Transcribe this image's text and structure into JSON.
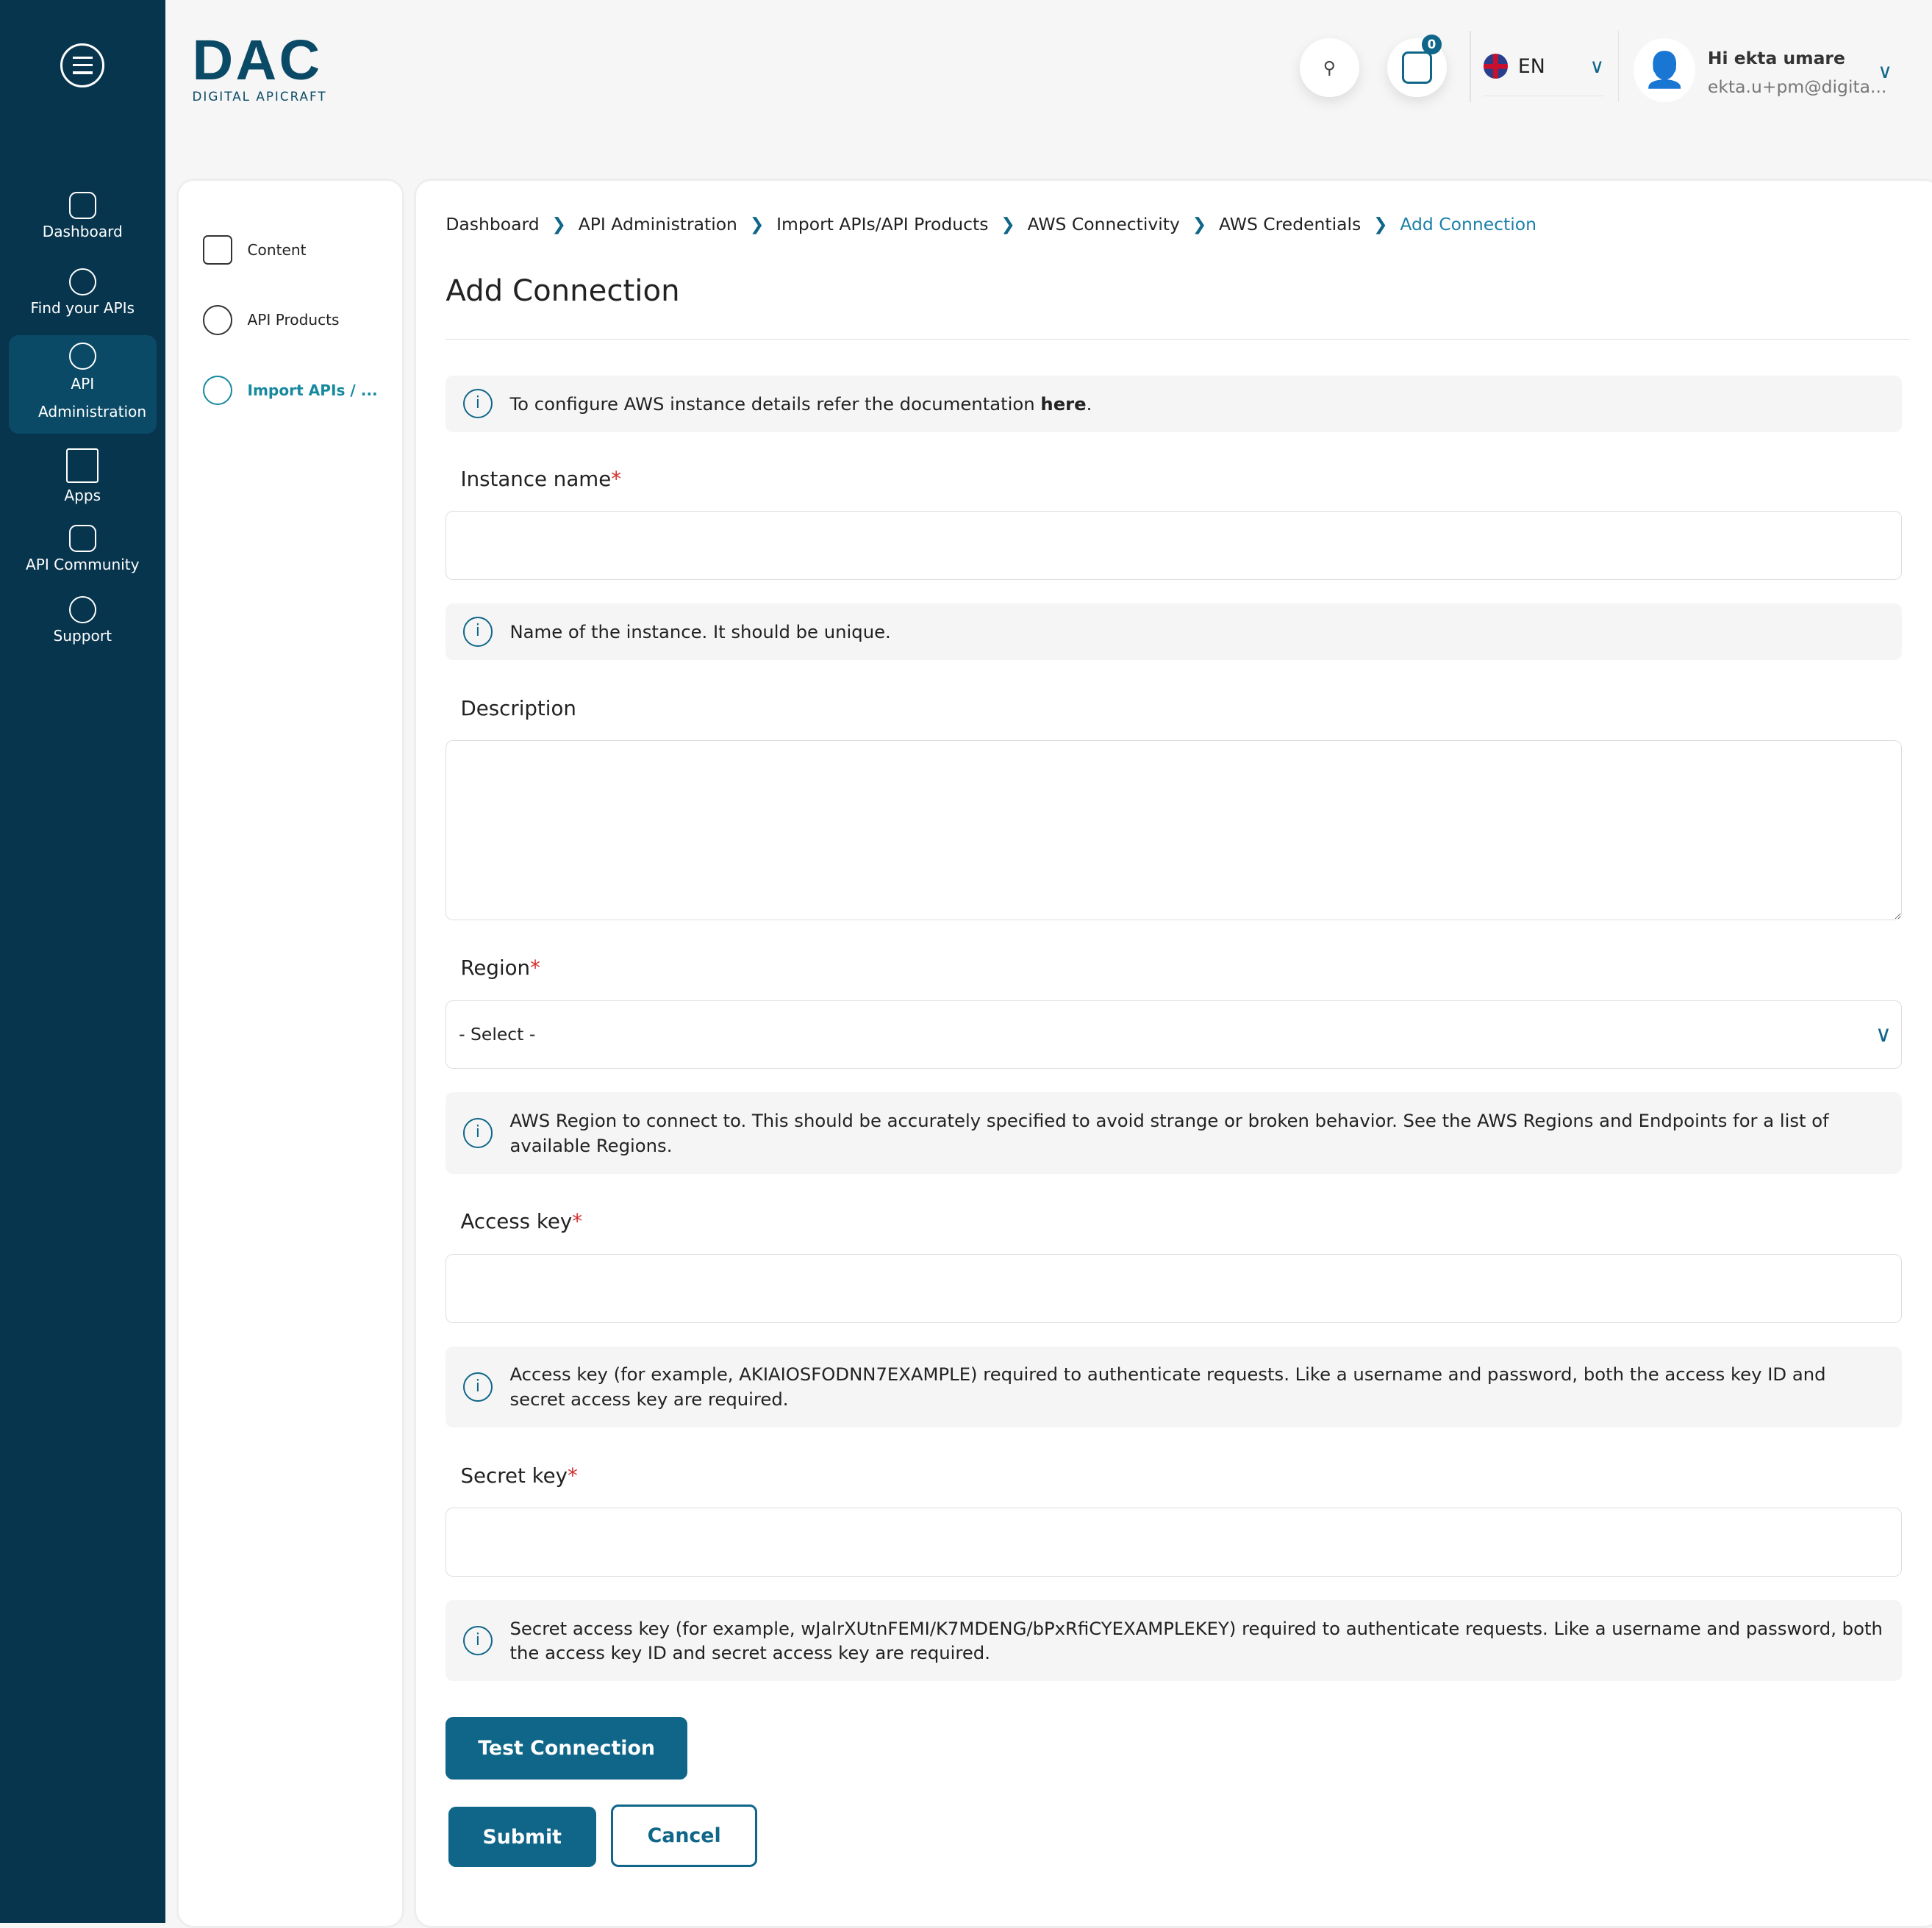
{
  "sidebar": {
    "items": [
      {
        "label": "Dashboard"
      },
      {
        "label": "Find your APIs"
      },
      {
        "label": "API Administration"
      },
      {
        "label": "Apps"
      },
      {
        "label": "API Community"
      },
      {
        "label": "Support"
      }
    ]
  },
  "logo": {
    "big": "DAC",
    "small": "DIGITAL APICRAFT"
  },
  "header": {
    "notification_count": "0",
    "language": "EN",
    "greeting": "Hi ekta umare",
    "email": "ekta.u+pm@digita..."
  },
  "subnav": {
    "items": [
      {
        "label": "Content"
      },
      {
        "label": "API Products"
      },
      {
        "label": "Import APIs / ..."
      }
    ]
  },
  "breadcrumb": [
    "Dashboard",
    "API Administration",
    "Import APIs/API Products",
    "AWS Connectivity",
    "AWS Credentials",
    "Add Connection"
  ],
  "page_title": "Add Connection",
  "doc_info": {
    "text": "To configure AWS instance details refer the documentation ",
    "link": "here",
    "end": "."
  },
  "form": {
    "instance_name": {
      "label": "Instance name",
      "value": "",
      "help": "Name of the instance. It should be unique."
    },
    "description": {
      "label": "Description",
      "value": ""
    },
    "region": {
      "label": "Region",
      "selected": "- Select -",
      "help": "AWS Region to connect to. This should be accurately specified to avoid strange or broken behavior. See the AWS Regions and Endpoints for a list of available Regions."
    },
    "access_key": {
      "label": "Access key",
      "value": "",
      "help": "Access key (for example, AKIAIOSFODNN7EXAMPLE) required to authenticate requests. Like a username and password, both the access key ID and secret access key are required."
    },
    "secret_key": {
      "label": "Secret key",
      "value": "",
      "help": "Secret access key (for example, wJalrXUtnFEMI/K7MDENG/bPxRfiCYEXAMPLEKEY) required to authenticate requests. Like a username and password, both the access key ID and secret access key are required."
    },
    "required_mark": "*"
  },
  "buttons": {
    "test": "Test Connection",
    "submit": "Submit",
    "cancel": "Cancel"
  }
}
